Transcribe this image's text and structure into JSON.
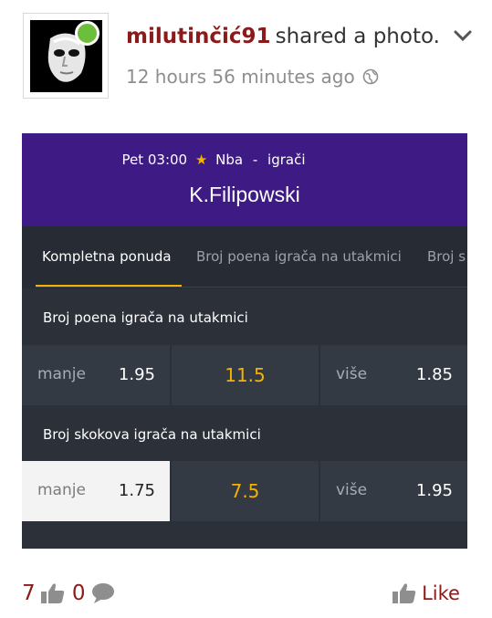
{
  "post": {
    "username": "milutinčić91",
    "action": "shared a photo.",
    "timestamp": "12 hours 56 minutes ago"
  },
  "photo": {
    "match": {
      "time": "Pet 03:00",
      "league": "Nba",
      "separator": "-",
      "category": "igrači",
      "player": "K.Filipowski"
    },
    "tabs": [
      {
        "label": "Kompletna ponuda",
        "active": true
      },
      {
        "label": "Broj poena igrača na utakmici",
        "active": false
      },
      {
        "label": "Broj s",
        "active": false
      }
    ],
    "markets": [
      {
        "title": "Broj poena igrača na utakmici",
        "under_label": "manje",
        "under_odds": "1.95",
        "line": "11.5",
        "over_label": "više",
        "over_odds": "1.85"
      },
      {
        "title": "Broj skokova igrača na utakmici",
        "under_label": "manje",
        "under_odds": "1.75",
        "line": "7.5",
        "over_label": "više",
        "over_odds": "1.95"
      }
    ]
  },
  "footer": {
    "likes_count": "7",
    "comments_count": "0",
    "like_label": "Like"
  },
  "colors": {
    "accent": "#8b1a1a",
    "header_purple": "#3e1a84",
    "odds_yellow": "#f5b301",
    "online_green": "#6dbe3a"
  },
  "icons": [
    "chevron-down-icon",
    "globe-icon",
    "star-icon",
    "thumbs-up-icon",
    "comment-bubble-icon"
  ]
}
